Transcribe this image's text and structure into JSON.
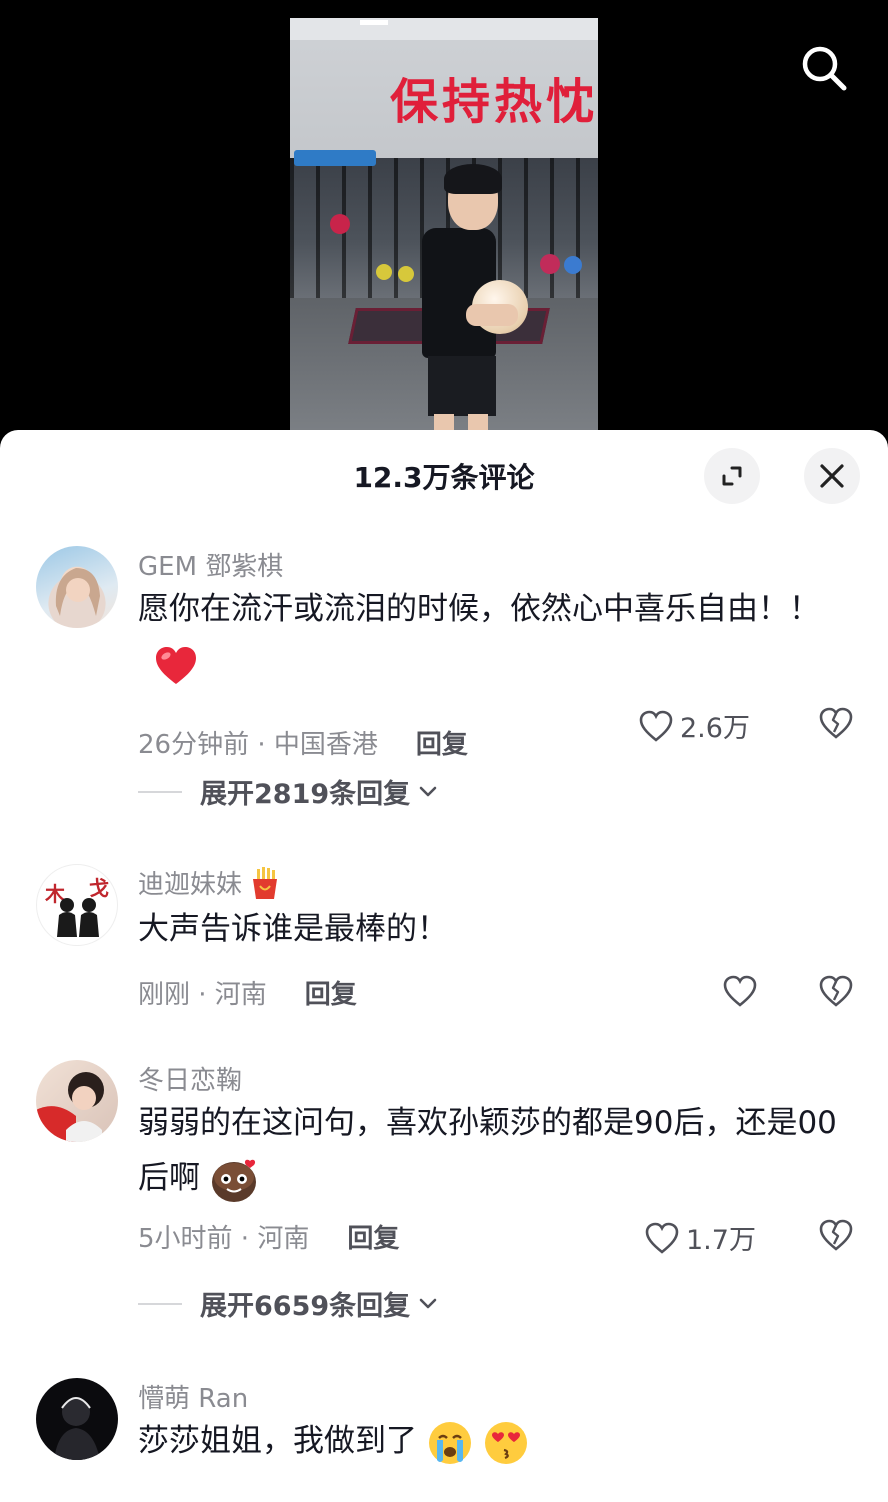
{
  "video": {
    "wall_text": "保持热忱"
  },
  "search": {
    "icon": "search-icon"
  },
  "sheet": {
    "title": "12.3万条评论",
    "expand_icon": "expand-icon",
    "close_icon": "close-icon"
  },
  "comments": [
    {
      "username": "GEM 鄧紫棋",
      "text": "愿你在流汗或流泪的时候，依然心中喜乐自由！！",
      "emoji": "heart",
      "time_location": "26分钟前 · 中国香港",
      "reply_label": "回复",
      "likes": "2.6万",
      "expand_replies": "展开2819条回复"
    },
    {
      "username": "迪迦妹妹",
      "username_badge": "fries",
      "text": "大声告诉谁是最棒的！",
      "time_location": "刚刚 · 河南",
      "reply_label": "回复",
      "likes": ""
    },
    {
      "username": "冬日恋鞠",
      "text": "弱弱的在这问句，喜欢孙颖莎的都是90后，还是00后啊",
      "emoji": "heart-eyes-brown",
      "time_location": "5小时前 · 河南",
      "reply_label": "回复",
      "likes": "1.7万",
      "expand_replies": "展开6659条回复"
    },
    {
      "username": "懵萌 Ran",
      "text": "莎莎姐姐，我做到了",
      "emoji": "crying-and-kissing"
    }
  ],
  "colors": {
    "brand_red": "#fe2c55",
    "heart_red": "#e8273b",
    "text_primary": "#161823",
    "text_secondary": "#8a8b91"
  }
}
